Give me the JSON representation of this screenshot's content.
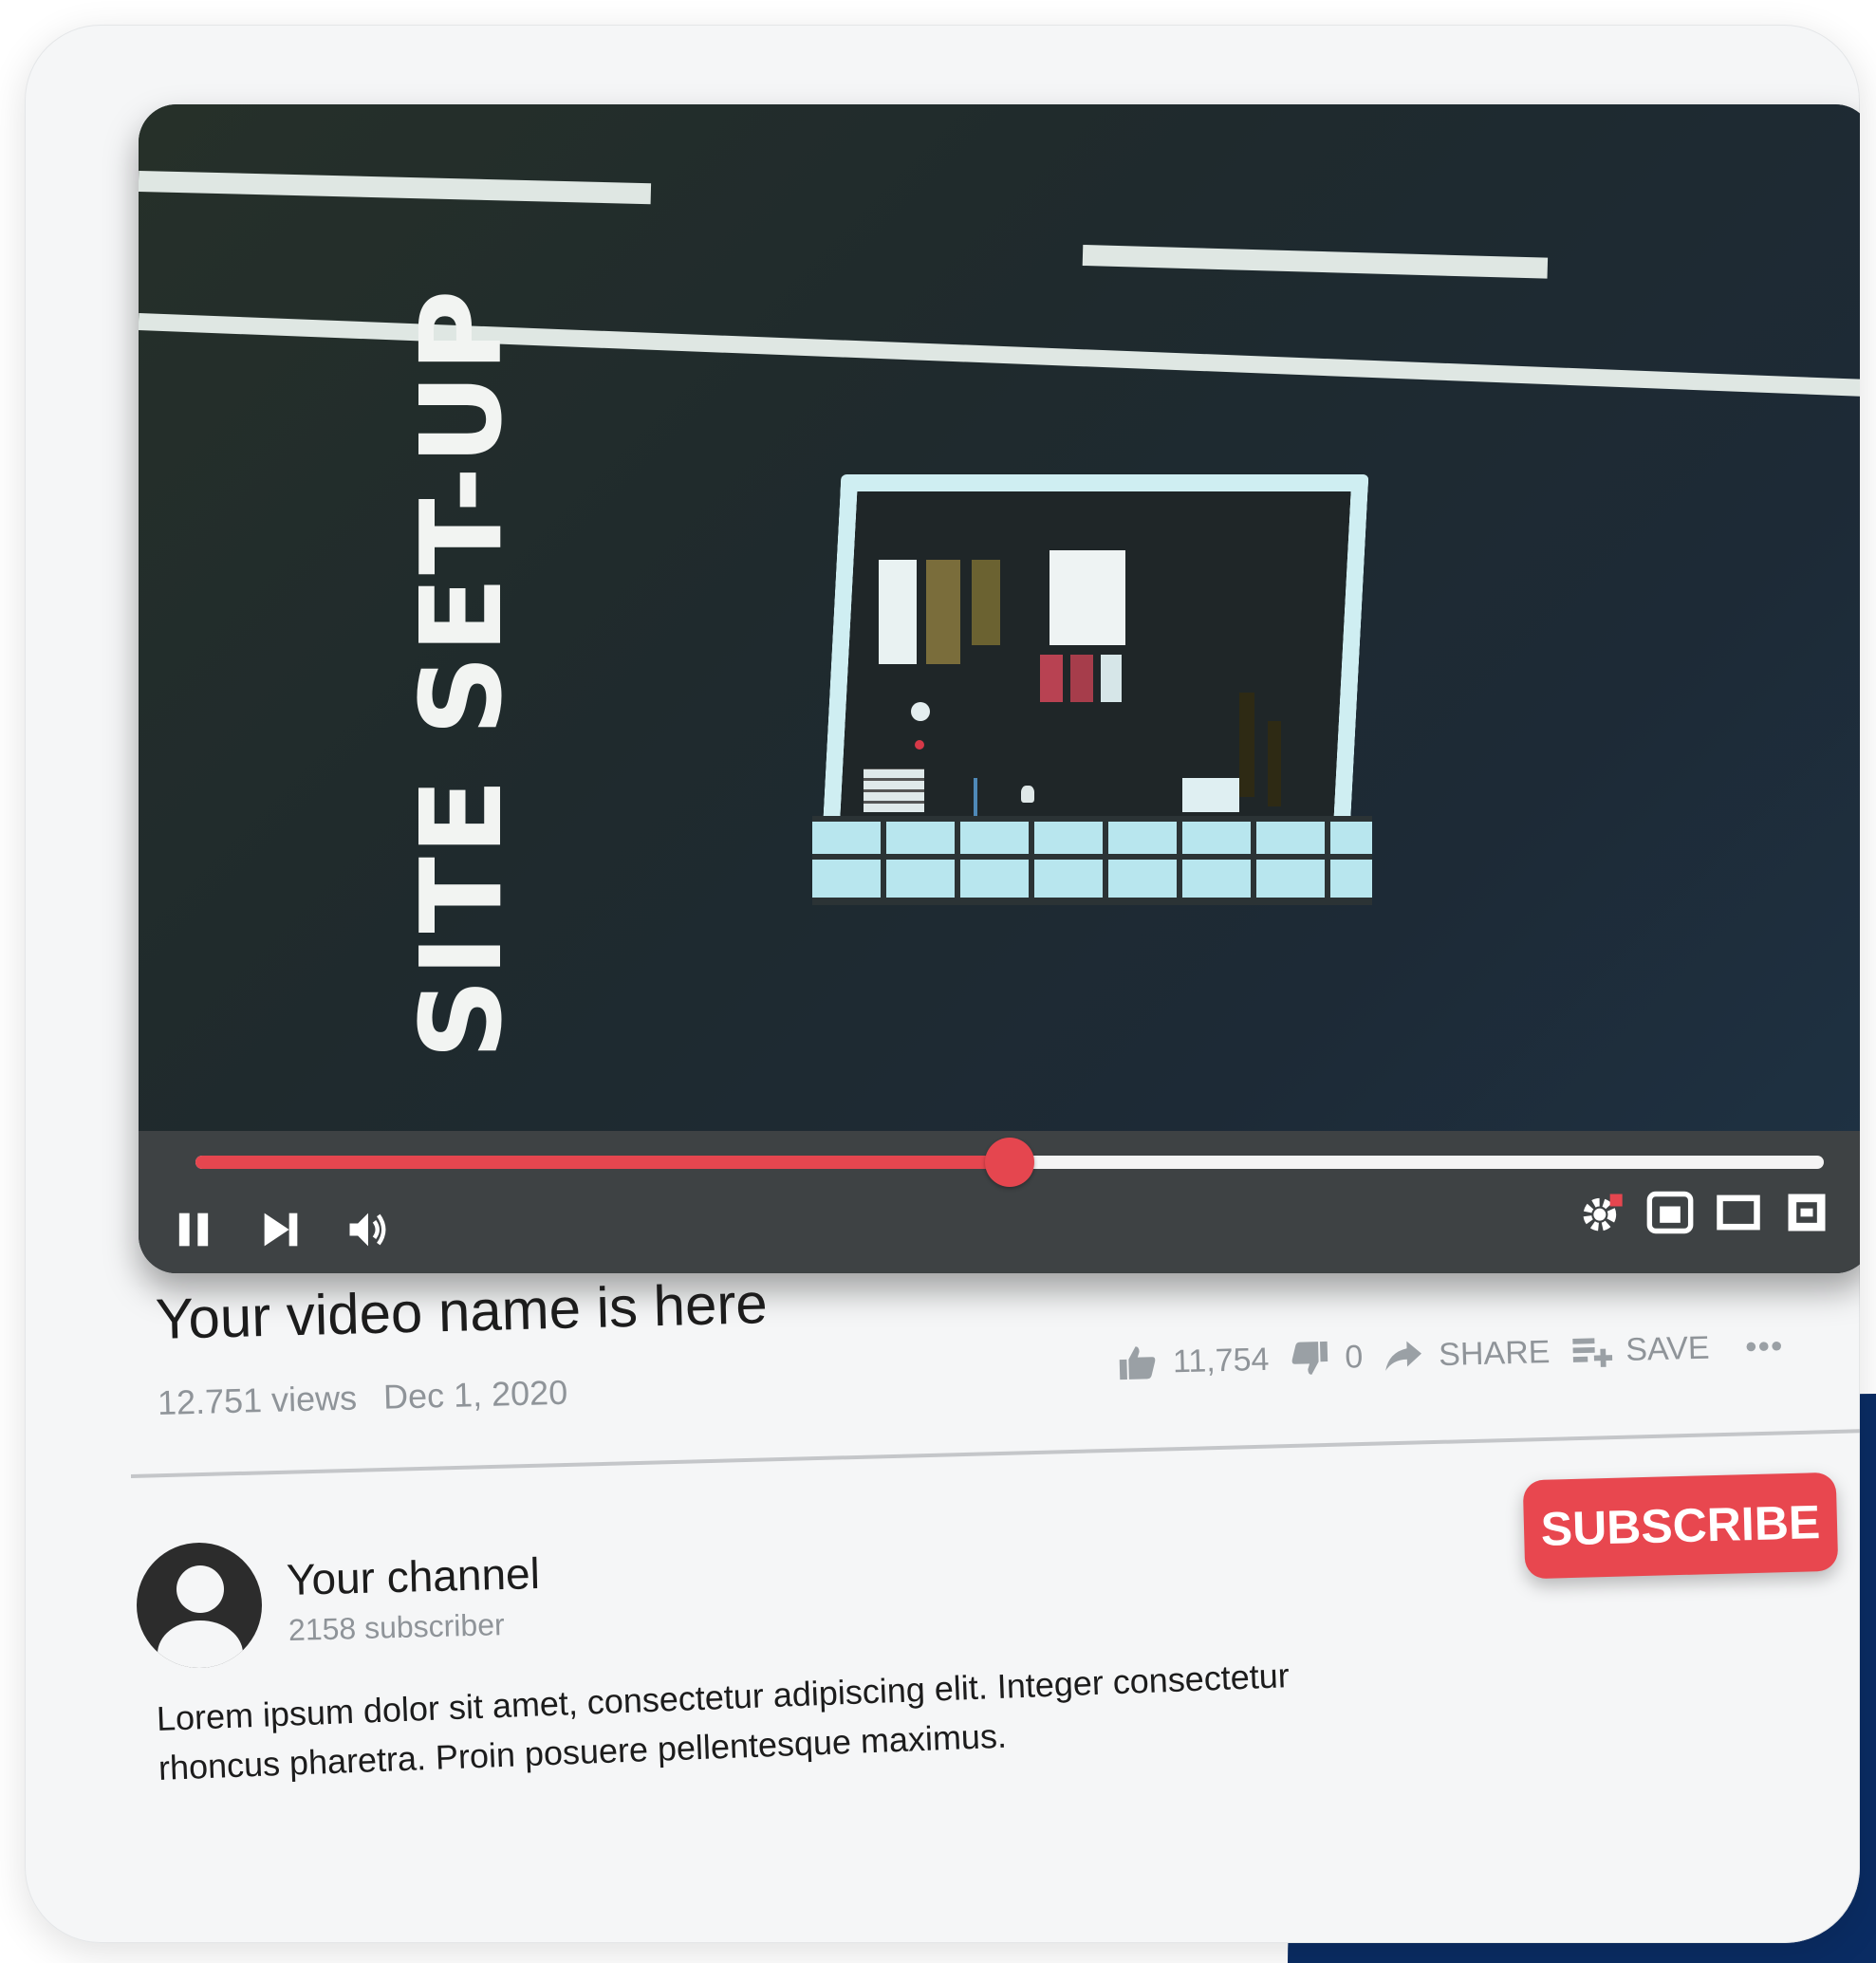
{
  "video": {
    "overlay_text": "SITE SET-UP",
    "title": "Your video name is here",
    "views": "12.751 views",
    "date": "Dec 1, 2020",
    "progress": 0.5
  },
  "controls": {
    "left": [
      {
        "name": "pause-button",
        "icon": "pause-icon"
      },
      {
        "name": "next-button",
        "icon": "skip-next-icon"
      },
      {
        "name": "volume-button",
        "icon": "volume-icon"
      }
    ],
    "right": [
      {
        "name": "settings-button",
        "icon": "gear-icon"
      },
      {
        "name": "miniplayer-button",
        "icon": "miniplayer-icon"
      },
      {
        "name": "theater-button",
        "icon": "theater-icon"
      },
      {
        "name": "fullscreen-button",
        "icon": "fullscreen-icon"
      }
    ]
  },
  "actions": {
    "like_count": "11,754",
    "dislike_count": "0",
    "share_label": "SHARE",
    "save_label": "SAVE",
    "more_icon": "more-icon"
  },
  "channel": {
    "name": "Your channel",
    "subscribers": "2158 subscriber",
    "subscribe_label": "SUBSCRIBE"
  },
  "description": "Lorem ipsum dolor sit amet, consectetur adipiscing elit. Integer consectetur rhoncus pharetra. Proin posuere pellentesque maximus.",
  "colors": {
    "accent": "#e5464f",
    "control_bar": "#3e4244",
    "muted_text": "#8f9499",
    "background_shape": "#0a2c63"
  }
}
